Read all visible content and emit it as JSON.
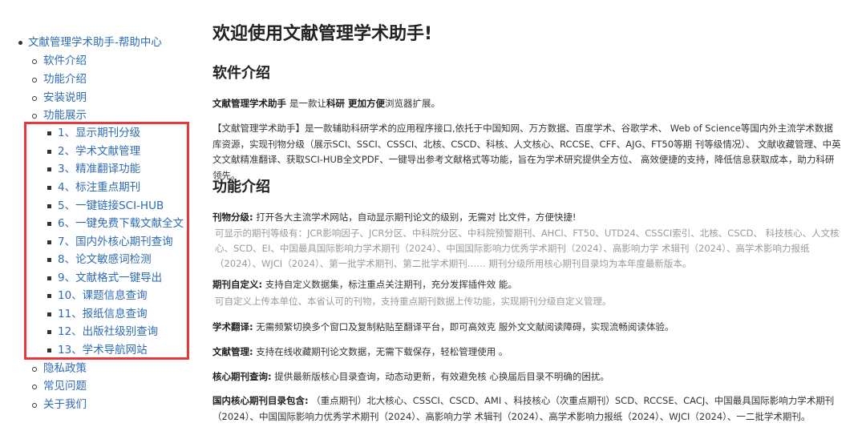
{
  "toc": {
    "root": "文献管理学术助手-帮助中心",
    "items": [
      {
        "label": "软件介绍"
      },
      {
        "label": "功能介绍"
      },
      {
        "label": "安装说明"
      },
      {
        "label": "功能展示",
        "children": [
          "1、显示期刊分级",
          "2、学术文献管理",
          "3、精准翻译功能",
          "4、标注重点期刊",
          "5、一键链接SCI-HUB",
          "6、一键免费下载文献全文",
          "7、国内外核心期刊查询",
          "8、论文敏感词检测",
          "9、文献格式一键导出",
          "10、课题信息查询",
          "11、报纸信息查询",
          "12、出版社级别查询",
          "13、学术导航网站"
        ]
      },
      {
        "label": "隐私政策"
      },
      {
        "label": "常见问题"
      },
      {
        "label": "关于我们"
      }
    ]
  },
  "main": {
    "title": "欢迎使用文献管理学术助手!",
    "section1": {
      "heading": "软件介绍",
      "tagline_pre": "文献管理学术助手 ",
      "tagline_mid1": "是一款让",
      "tagline_bold1": "科研 更加方便",
      "tagline_end": "浏览器扩展。",
      "desc": "【文献管理学术助手】是一款辅助科研学术的应用程序接口,依托于中国知网、万方数据、百度学术、谷歌学术、 Web of Science等国内外主流学术数据库资源，实现刊物分级（展示SCI、SSCI、CSSCI、北核、CSCD、科核、人文核心、RCCSE、CFF、AJG、FT50等期 刊等级情况）、 文献收藏管理、中英文文献精准翻译、获取SCI-HUB全文PDF、一键导出参考文献格式等功能，旨在为学术研究提供全方位、 高效便捷的支持，降低信息获取成本，助力科研领先。"
    },
    "section2": {
      "heading": "功能介绍",
      "f1_label": "刊物分级:",
      "f1_text": " 打开各大主流学术网站，自动显示期刊论文的级别，无需对 比文件，方便快捷!",
      "f1_gray": "可显示的期刊等级有：JCR影响因子、JCR分区、中科院分区、中科院预警期刊、AHCI、FT50、UTD24、CSSCI索引、北核、CSCD、 科技核心、人文核心、SCD、EI、中国最具国际影响力学术期刊（2024）、中国国际影响力优秀学术期刊（2024）、高影响力学 术辑刊（2024）、高学术影响力报纸（2024）、WJCI（2024）、第一批学术期刊、第二批学术期刊…… 期刊分级所用核心期刊目录均为本年度最新版本。",
      "f2_label": "期刊自定义:",
      "f2_text": " 支持自定义数据集，标注重点关注期刊，充分发挥插件效 能。",
      "f2_gray": "可自定义上传本单位、本省认可的刊物，支持重点期刊数据上传功能，实现期刊分级自定义管理。",
      "f3_label": "学术翻译:",
      "f3_text": " 无需频繁切换多个窗口及复制粘贴至翻译平台，即可高效克 服外文文献阅读障碍，实现流畅阅读体验。",
      "f4_label": "文献管理:",
      "f4_text": " 支持在线收藏期刊论文数据，无需下载保存，轻松管理使用 。",
      "f5_label": "核心期刊查询:",
      "f5_text": " 提供最新版核心目录查询，动态动更新，有效避免核 心换届后目录不明确的困扰。",
      "f6_label": "国内核心期刊目录包含:",
      "f6_text": " （重点期刊）北大核心、CSSCI、CSCD、AMI 、科技核心（次重点期刊）SCD、RCCSE、CACJ、中国最具国际影响力学术期刊（2024）、中国国际影响力优秀学术期刊（2024）、高影响力学 术辑刊（2024）、高学术影响力报纸（2024）、WJCI（2024）、一二批学术期刊。"
    }
  },
  "colors": {
    "link": "#2f6bb5",
    "highlight_box": "#e8373d",
    "muted": "#9a9a9a"
  }
}
